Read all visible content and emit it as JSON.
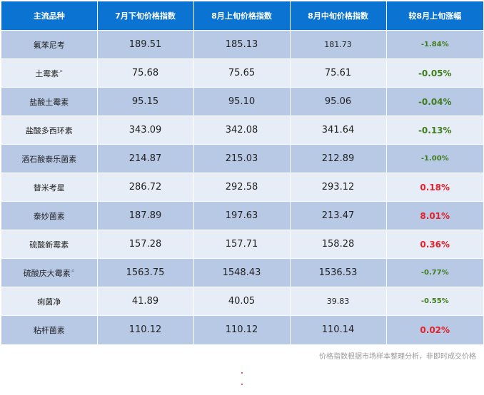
{
  "table": {
    "headers": [
      "主流品种",
      "7月下旬价格指数",
      "8月上旬价格指数",
      "8月中旬价格指数",
      "较8月上旬涨幅"
    ],
    "rows": [
      {
        "name": "氟苯尼考",
        "jul_late": "189.51",
        "aug_early": "185.13",
        "aug_mid": "181.73",
        "change": "-1.84%",
        "direction": "down",
        "search_icon": false
      },
      {
        "name": "土霉素",
        "jul_late": "75.68",
        "aug_early": "75.65",
        "aug_mid": "75.61",
        "change": "-0.05%",
        "direction": "down",
        "search_icon": true
      },
      {
        "name": "盐酸土霉素",
        "jul_late": "95.15",
        "aug_early": "95.10",
        "aug_mid": "95.06",
        "change": "-0.04%",
        "direction": "down",
        "search_icon": false
      },
      {
        "name": "盐酸多西环素",
        "jul_late": "343.09",
        "aug_early": "342.08",
        "aug_mid": "341.64",
        "change": "-0.13%",
        "direction": "down",
        "search_icon": false
      },
      {
        "name": "酒石酸泰乐菌素",
        "jul_late": "214.87",
        "aug_early": "215.03",
        "aug_mid": "212.89",
        "change": "-1.00%",
        "direction": "down",
        "search_icon": false
      },
      {
        "name": "替米考星",
        "jul_late": "286.72",
        "aug_early": "292.58",
        "aug_mid": "293.12",
        "change": "0.18%",
        "direction": "up",
        "search_icon": false
      },
      {
        "name": "泰妙菌素",
        "jul_late": "187.89",
        "aug_early": "197.63",
        "aug_mid": "213.47",
        "change": "8.01%",
        "direction": "up",
        "search_icon": false
      },
      {
        "name": "硫酸新霉素",
        "jul_late": "157.28",
        "aug_early": "157.71",
        "aug_mid": "158.28",
        "change": "0.36%",
        "direction": "up",
        "search_icon": false
      },
      {
        "name": "硫酸庆大霉素",
        "jul_late": "1563.75",
        "aug_early": "1548.43",
        "aug_mid": "1536.53",
        "change": "-0.77%",
        "direction": "down",
        "search_icon": true
      },
      {
        "name": "痢菌净",
        "jul_late": "41.89",
        "aug_early": "40.05",
        "aug_mid": "39.83",
        "change": "-0.55%",
        "direction": "down",
        "search_icon": false
      },
      {
        "name": "粘杆菌素",
        "jul_late": "110.12",
        "aug_early": "110.12",
        "aug_mid": "110.14",
        "change": "0.02%",
        "direction": "up",
        "search_icon": false
      }
    ]
  },
  "footer_note": "价格指数根据市场样本整理分析，非即时成交价格",
  "colors": {
    "header_bg": "#0b73d1",
    "row_dark": "#b8c9e6",
    "row_light": "#e7edf6",
    "rise": "#e8202a",
    "fall": "#3f7d1c"
  },
  "icons": {
    "search": "search-icon"
  }
}
